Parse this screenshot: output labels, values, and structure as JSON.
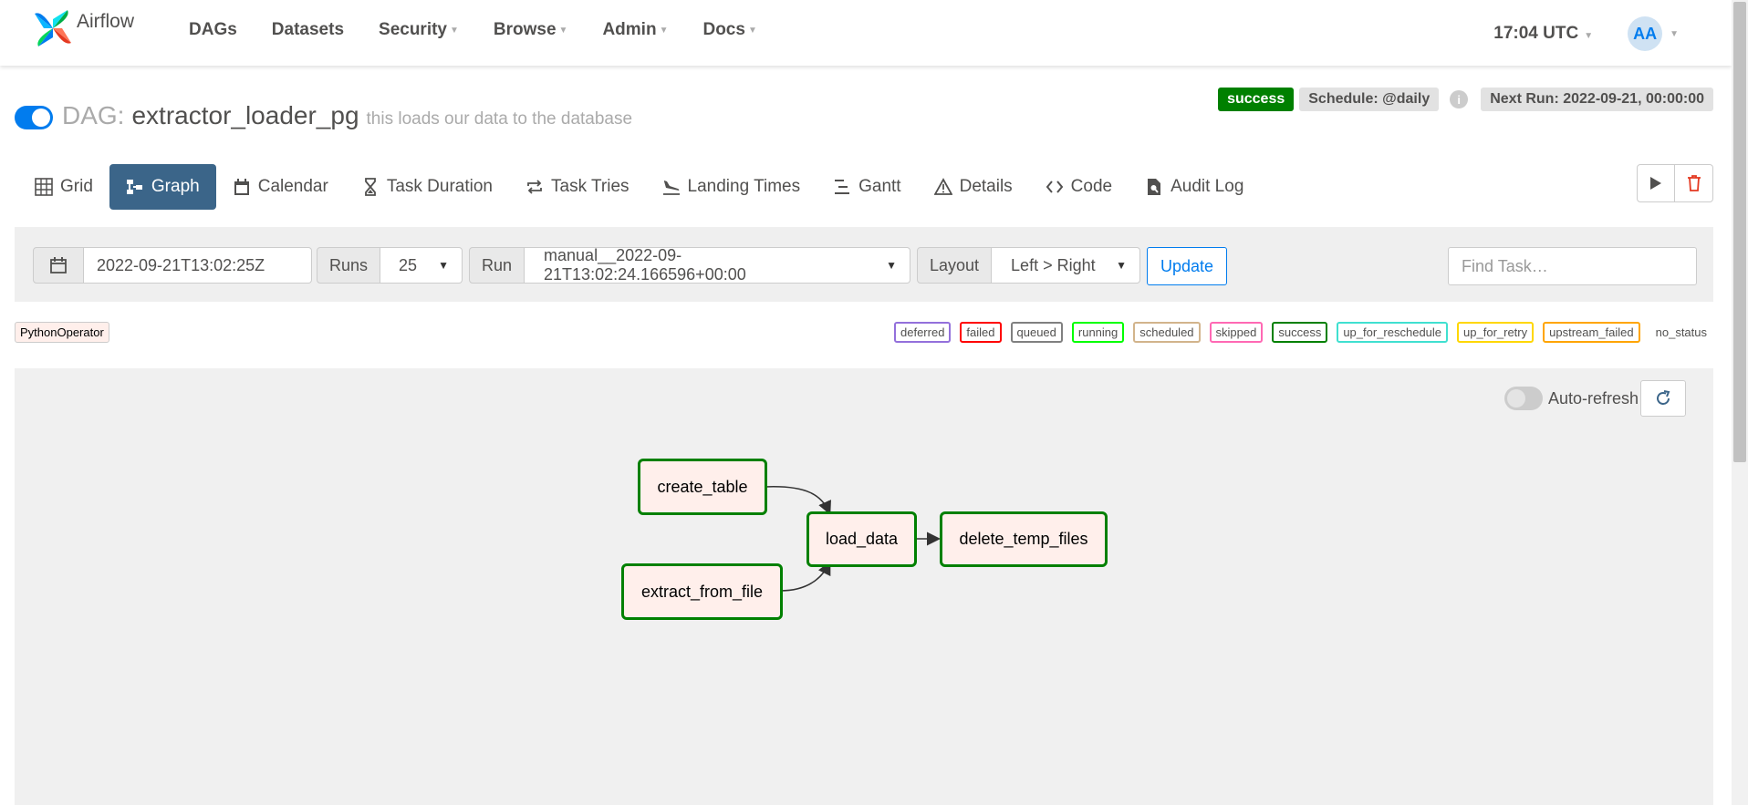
{
  "brand": {
    "name": "Airflow"
  },
  "nav": {
    "items": [
      {
        "label": "DAGs",
        "dropdown": false
      },
      {
        "label": "Datasets",
        "dropdown": false
      },
      {
        "label": "Security",
        "dropdown": true
      },
      {
        "label": "Browse",
        "dropdown": true
      },
      {
        "label": "Admin",
        "dropdown": true
      },
      {
        "label": "Docs",
        "dropdown": true
      }
    ],
    "time": "17:04 UTC",
    "avatar": "AA"
  },
  "dag": {
    "label": "DAG:",
    "id": "extractor_loader_pg",
    "description": "this loads our data to the database",
    "status": "success",
    "schedule": "Schedule: @daily",
    "next_run": "Next Run: 2022-09-21, 00:00:00"
  },
  "tabs": [
    {
      "label": "Grid",
      "icon": "grid-icon",
      "active": false
    },
    {
      "label": "Graph",
      "icon": "graph-icon",
      "active": true
    },
    {
      "label": "Calendar",
      "icon": "calendar-icon",
      "active": false
    },
    {
      "label": "Task Duration",
      "icon": "hourglass-icon",
      "active": false
    },
    {
      "label": "Task Tries",
      "icon": "repeat-icon",
      "active": false
    },
    {
      "label": "Landing Times",
      "icon": "plane-landing-icon",
      "active": false
    },
    {
      "label": "Gantt",
      "icon": "gantt-icon",
      "active": false
    },
    {
      "label": "Details",
      "icon": "warning-triangle-icon",
      "active": false
    },
    {
      "label": "Code",
      "icon": "code-icon",
      "active": false
    },
    {
      "label": "Audit Log",
      "icon": "file-search-icon",
      "active": false
    }
  ],
  "filters": {
    "base_date": "2022-09-21T13:02:25Z",
    "runs_label": "Runs",
    "runs_value": "25",
    "run_label": "Run",
    "run_value": "manual__2022-09-21T13:02:24.166596+00:00",
    "layout_label": "Layout",
    "layout_value": "Left > Right",
    "update_label": "Update",
    "find_placeholder": "Find Task…"
  },
  "operator": "PythonOperator",
  "legend": [
    {
      "label": "deferred",
      "color": "#9370db"
    },
    {
      "label": "failed",
      "color": "#ff0000"
    },
    {
      "label": "queued",
      "color": "#808080"
    },
    {
      "label": "running",
      "color": "#00ff00"
    },
    {
      "label": "scheduled",
      "color": "#d2b48c"
    },
    {
      "label": "skipped",
      "color": "#ff69b4"
    },
    {
      "label": "success",
      "color": "#008000"
    },
    {
      "label": "up_for_reschedule",
      "color": "#40e0d0"
    },
    {
      "label": "up_for_retry",
      "color": "#ffd700"
    },
    {
      "label": "upstream_failed",
      "color": "#ffa500"
    },
    {
      "label": "no_status",
      "color": ""
    }
  ],
  "graph": {
    "auto_refresh_label": "Auto-refresh",
    "nodes": [
      {
        "id": "create_table",
        "label": "create_table"
      },
      {
        "id": "extract_from_file",
        "label": "extract_from_file"
      },
      {
        "id": "load_data",
        "label": "load_data"
      },
      {
        "id": "delete_temp_files",
        "label": "delete_temp_files"
      }
    ],
    "edges": [
      {
        "from": "create_table",
        "to": "load_data"
      },
      {
        "from": "extract_from_file",
        "to": "load_data"
      },
      {
        "from": "load_data",
        "to": "delete_temp_files"
      }
    ]
  }
}
